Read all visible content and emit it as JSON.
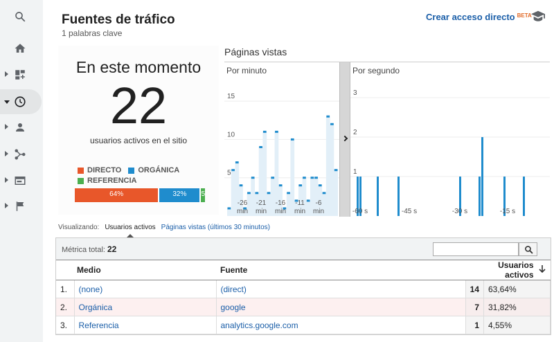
{
  "header": {
    "title": "Fuentes de tráfico",
    "subtitle": "1 palabras clave",
    "shortcut_label": "Crear acceso directo",
    "beta_label": "BETA"
  },
  "now": {
    "title": "En este momento",
    "active_users": "22",
    "caption": "usuarios activos en el sitio",
    "legend": [
      {
        "label": "DIRECTO",
        "color": "#e8572a"
      },
      {
        "label": "ORGÁNICA",
        "color": "#1f8ccd"
      },
      {
        "label": "REFERENCIA",
        "color": "#4caf50"
      }
    ],
    "bar": [
      {
        "label": "64%",
        "value": 64,
        "color": "#e8572a"
      },
      {
        "label": "32%",
        "value": 32,
        "color": "#1f8ccd"
      },
      {
        "label": "5%",
        "value": 4,
        "color": "#4caf50"
      }
    ]
  },
  "pageviews": {
    "title": "Páginas vistas",
    "per_minute_label": "Por minuto",
    "per_second_label": "Por segundo"
  },
  "chart_data": [
    {
      "type": "bar",
      "title": "Por minuto",
      "y_ticks": [
        "15",
        "10",
        "5"
      ],
      "ylim": [
        0,
        17
      ],
      "x_tick_labels": [
        "-26 min",
        "-21 min",
        "-16 min",
        "-11 min",
        "-6 min"
      ],
      "values": [
        1,
        6,
        7,
        4,
        1,
        3,
        5,
        3,
        9,
        11,
        3,
        5,
        11,
        4,
        1,
        3,
        10,
        2,
        4,
        5,
        2,
        5,
        5,
        4,
        3,
        13,
        12,
        6
      ]
    },
    {
      "type": "bar",
      "title": "Por segundo",
      "y_ticks": [
        "3",
        "2",
        "1"
      ],
      "ylim": [
        0,
        3.3
      ],
      "x_tick_labels": [
        "-60 s",
        "-45 s",
        "-30 s",
        "-15 s"
      ],
      "values": [
        1,
        1,
        1,
        1,
        1,
        1,
        2,
        1,
        1
      ]
    }
  ],
  "visualizing": {
    "label": "Visualizando:",
    "active_tab": "Usuarios activos",
    "other_tab": "Páginas vistas (últimos 30 minutos)"
  },
  "table": {
    "metric_label": "Métrica total:",
    "metric_value": "22",
    "search_placeholder": "",
    "headers": {
      "medium": "Medio",
      "source": "Fuente",
      "users": "Usuarios activos"
    },
    "rows": [
      {
        "idx": "1.",
        "medium": "(none)",
        "source": "(direct)",
        "users": "14",
        "pct": "63,64%"
      },
      {
        "idx": "2.",
        "medium": "Orgánica",
        "source": "google",
        "users": "7",
        "pct": "31,82%"
      },
      {
        "idx": "3.",
        "medium": "Referencia",
        "source": "analytics.google.com",
        "users": "1",
        "pct": "4,55%"
      }
    ]
  }
}
